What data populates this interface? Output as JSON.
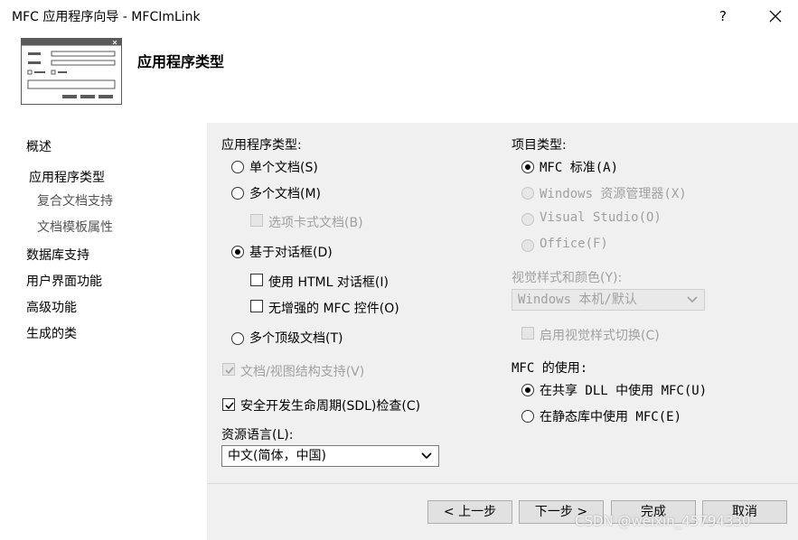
{
  "window": {
    "title": "MFC 应用程序向导 - MFCImLink",
    "help_label": "?",
    "close_icon": "close-icon"
  },
  "header": {
    "title": "应用程序类型",
    "icon": "dialog-window-icon"
  },
  "nav": {
    "items": [
      {
        "label": "概述"
      },
      {
        "label": "应用程序类型"
      },
      {
        "label": "复合文档支持"
      },
      {
        "label": "文档模板属性"
      },
      {
        "label": "数据库支持"
      },
      {
        "label": "用户界面功能"
      },
      {
        "label": "高级功能"
      },
      {
        "label": "生成的类"
      }
    ]
  },
  "app_type": {
    "heading": "应用程序类型:",
    "single_doc": "单个文档(S)",
    "multi_doc": "多个文档(M)",
    "tabbed_docs": "选项卡式文档(B)",
    "dialog_based": "基于对话框(D)",
    "use_html_dialog": "使用 HTML 对话框(I)",
    "no_enhanced_mfc": "无增强的 MFC 控件(O)",
    "multi_toplevel": "多个顶级文档(T)",
    "doc_view": "文档/视图结构支持(V)",
    "sdl_check": "安全开发生命周期(SDL)检查(C)",
    "resource_lang_label": "资源语言(L):",
    "resource_lang_value": "中文(简体，中国)"
  },
  "project_type": {
    "heading": "项目类型:",
    "mfc_standard": "MFC 标准(A)",
    "windows_explorer": "Windows 资源管理器(X)",
    "visual_studio": "Visual Studio(O)",
    "office": "Office(F)",
    "visual_style_label": "视觉样式和颜色(Y):",
    "visual_style_value": "Windows 本机/默认",
    "enable_style_switch": "启用视觉样式切换(C)"
  },
  "mfc_use": {
    "heading": "MFC 的使用:",
    "shared_dll": "在共享 DLL 中使用 MFC(U)",
    "static_lib": "在静态库中使用 MFC(E)"
  },
  "buttons": {
    "back": "< 上一步",
    "next": "下一步 >",
    "finish": "完成",
    "cancel": "取消"
  },
  "watermark": "CSDN @weixin_45794330"
}
